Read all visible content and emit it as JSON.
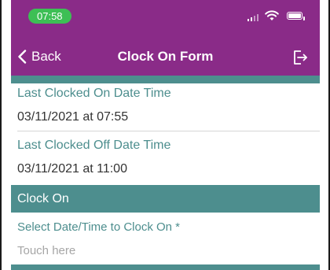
{
  "status_bar": {
    "time": "07:58",
    "time_pill_color": "#3dbf55"
  },
  "nav": {
    "back_label": "Back",
    "title": "Clock On Form",
    "logout_icon": "logout-icon"
  },
  "colors": {
    "header": "#8a2b88",
    "accent": "#4d8e8e"
  },
  "last_clocked_on": {
    "label": "Last Clocked On Date Time",
    "value": "03/11/2021 at 07:55"
  },
  "last_clocked_off": {
    "label": "Last Clocked Off Date Time",
    "value": "03/11/2021 at 11:00"
  },
  "clock_on_section": {
    "title": "Clock On",
    "select_label": "Select Date/Time to Clock On *",
    "placeholder": "Touch here"
  }
}
